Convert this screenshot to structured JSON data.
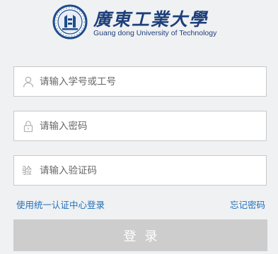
{
  "logo": {
    "name_cn": "廣東工業大學",
    "name_en": "Guang dong University of Technology"
  },
  "fields": {
    "username": {
      "placeholder": "请输入学号或工号",
      "icon": "user-icon"
    },
    "password": {
      "placeholder": "请输入密码",
      "icon": "lock-icon"
    },
    "captcha": {
      "placeholder": "请输入验证码",
      "icon_text": "验"
    }
  },
  "links": {
    "unified_auth": "使用统一认证中心登录",
    "forgot_password": "忘记密码"
  },
  "login_button": {
    "label": "登录"
  },
  "colors": {
    "background": "#f0f1f3",
    "brand": "#1d3f7a",
    "link": "#1e6fb8",
    "button_disabled": "#cdcdcd"
  }
}
